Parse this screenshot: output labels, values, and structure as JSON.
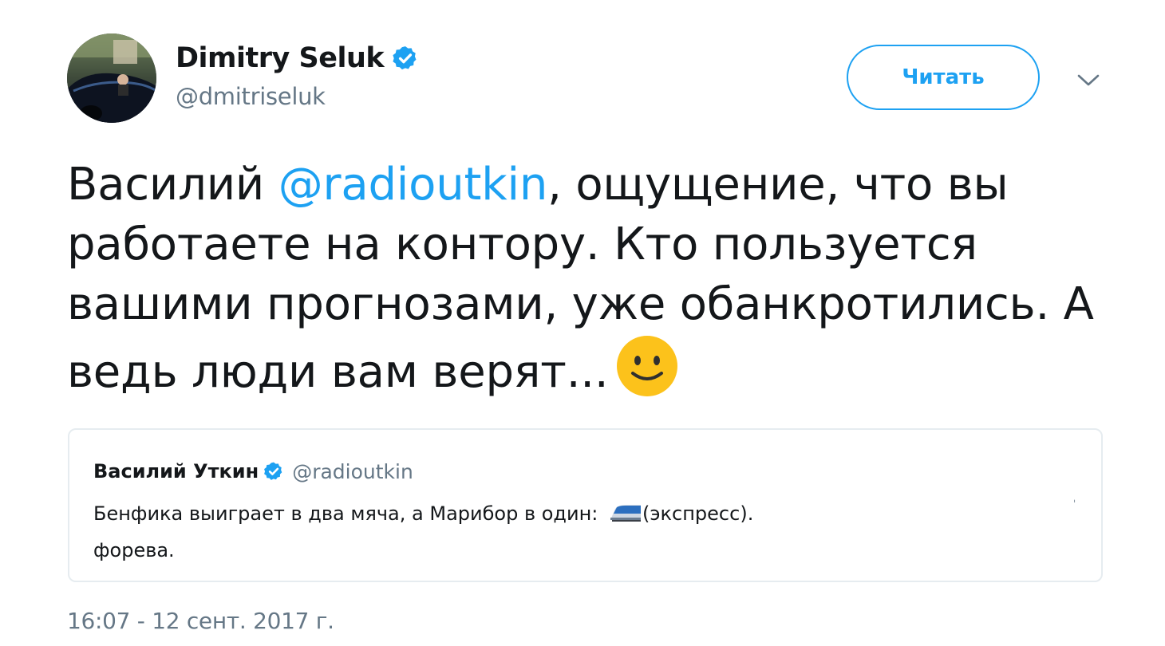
{
  "author": {
    "name": "Dimitry Seluk",
    "handle": "@dmitriseluk",
    "verified": true,
    "avatar_icon": "avatar-photo-car"
  },
  "actions": {
    "follow_label": "Читать",
    "menu_icon": "chevron-down-icon"
  },
  "tweet": {
    "text_prefix": "Василий ",
    "mention": "@radioutkin",
    "line1_suffix": ", ощущение, что вы",
    "line2": "работаете на контору. Кто пользуется",
    "line3": "вашими прогнозами, уже обанкротились. А",
    "line4": "ведь люди вам верят...",
    "emoji": "slightly-smiling-face-icon"
  },
  "quoted_tweet": {
    "name": "Василий Уткин",
    "handle": "@radioutkin",
    "verified": true,
    "line1_text": "Бенфика выиграет в два мяча, а Марибор в один: ",
    "line1_emoji": "high-speed-train-icon",
    "line1_suffix": "(экспресс).",
    "line2": "форева."
  },
  "timestamp": "16:07 - 12 сент. 2017 г.",
  "colors": {
    "accent": "#1da1f2",
    "text": "#14171a",
    "muted": "#657786",
    "border": "#e6ecf0"
  }
}
